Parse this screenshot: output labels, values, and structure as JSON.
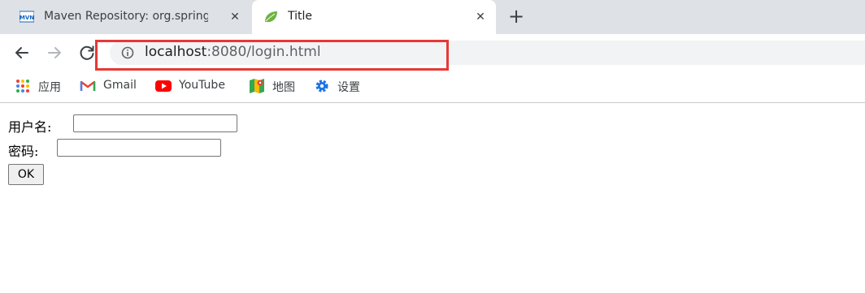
{
  "tabs": [
    {
      "title": "Maven Repository: org.springframework",
      "favicon": "mvn-icon",
      "active": false,
      "close_label": "✕"
    },
    {
      "title": "Title",
      "favicon": "spring-leaf-icon",
      "active": true,
      "close_label": "✕"
    }
  ],
  "new_tab_label": "+",
  "address": {
    "host": "localhost",
    "rest": ":8080/login.html"
  },
  "bookmarks": [
    {
      "label": "应用",
      "icon": "apps-grid-icon"
    },
    {
      "label": "Gmail",
      "icon": "gmail-icon"
    },
    {
      "label": "YouTube",
      "icon": "youtube-icon"
    },
    {
      "label": "地图",
      "icon": "maps-icon"
    },
    {
      "label": "设置",
      "icon": "settings-gear-icon"
    }
  ],
  "form": {
    "username_label": "用户名:",
    "username_value": "",
    "password_label": "密码:",
    "password_value": "",
    "submit_label": "OK"
  },
  "colors": {
    "highlight": "#e53935",
    "tabstrip": "#dee1e6",
    "omnibox": "#f1f3f4"
  }
}
